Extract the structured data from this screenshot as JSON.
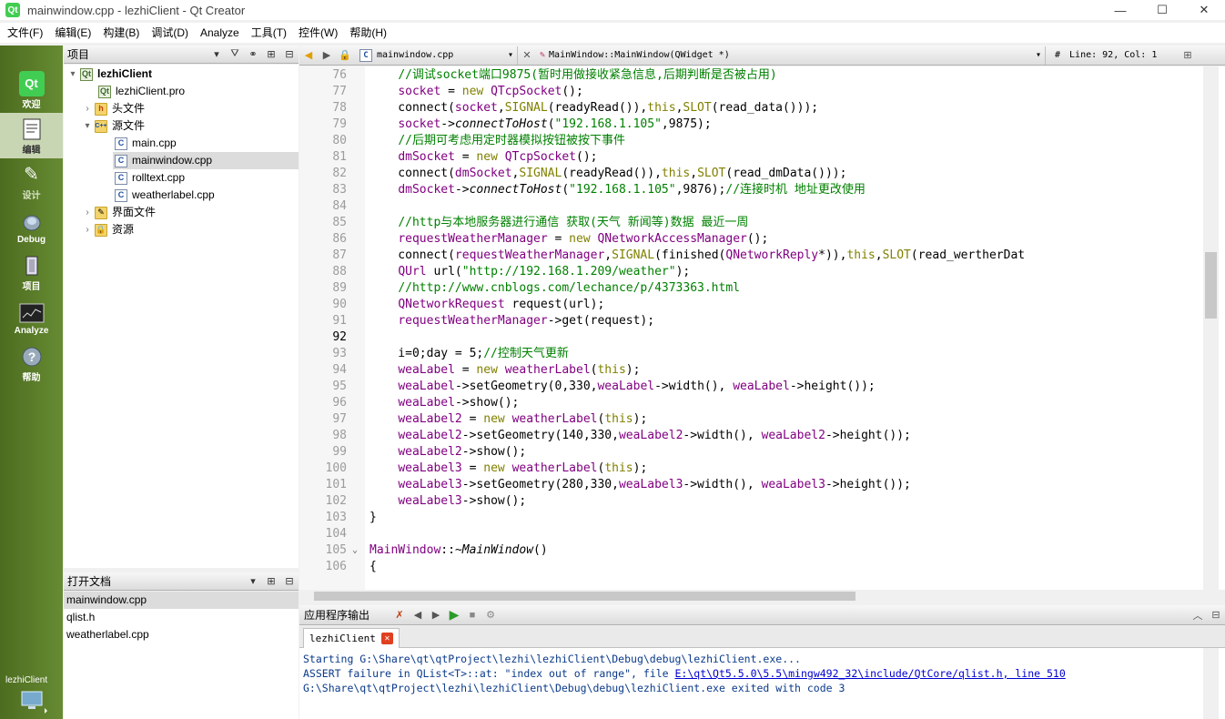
{
  "window": {
    "title": "mainwindow.cpp - lezhiClient - Qt Creator",
    "min": "—",
    "max": "☐",
    "close": "✕"
  },
  "menu": [
    "文件(F)",
    "编辑(E)",
    "构建(B)",
    "调试(D)",
    "Analyze",
    "工具(T)",
    "控件(W)",
    "帮助(H)"
  ],
  "modes": [
    {
      "label": "欢迎",
      "icon": "qt-logo-icon"
    },
    {
      "label": "编辑",
      "icon": "edit-document-icon"
    },
    {
      "label": "设计",
      "icon": "design-pen-icon"
    },
    {
      "label": "Debug",
      "icon": "debug-bug-icon"
    },
    {
      "label": "项目",
      "icon": "project-wrench-icon"
    },
    {
      "label": "Analyze",
      "icon": "analyze-chart-icon"
    },
    {
      "label": "帮助",
      "icon": "help-icon"
    }
  ],
  "kit": {
    "project": "lezhiClient"
  },
  "projects_panel": {
    "title": "项目"
  },
  "tree": [
    {
      "label": "lezhiClient",
      "type": "project"
    },
    {
      "label": "lezhiClient.pro",
      "type": "pro"
    },
    {
      "label": "头文件",
      "type": "folder-h"
    },
    {
      "label": "源文件",
      "type": "folder-cpp"
    },
    {
      "label": "main.cpp",
      "type": "cpp"
    },
    {
      "label": "mainwindow.cpp",
      "type": "cpp"
    },
    {
      "label": "rolltext.cpp",
      "type": "cpp"
    },
    {
      "label": "weatherlabel.cpp",
      "type": "cpp"
    },
    {
      "label": "界面文件",
      "type": "folder-ui"
    },
    {
      "label": "资源",
      "type": "folder-res"
    }
  ],
  "open_docs": {
    "title": "打开文档",
    "items": [
      "mainwindow.cpp",
      "qlist.h",
      "weatherlabel.cpp"
    ]
  },
  "editor_toolbar": {
    "file": "mainwindow.cpp",
    "symbol": "MainWindow::MainWindow(QWidget *)",
    "hash": "#",
    "position": "Line: 92, Col: 1"
  },
  "code": [
    {
      "n": "76",
      "t": "    //调试socket端口9875(暂时用做接收紧急信息,后期判断是否被占用)"
    },
    {
      "n": "77",
      "t": "    socket = new QTcpSocket();"
    },
    {
      "n": "78",
      "t": "    connect(socket,SIGNAL(readyRead()),this,SLOT(read_data()));"
    },
    {
      "n": "79",
      "t": "    socket->connectToHost(\"192.168.1.105\",9875);"
    },
    {
      "n": "80",
      "t": "    //后期可考虑用定时器模拟按钮被按下事件"
    },
    {
      "n": "81",
      "t": "    dmSocket = new QTcpSocket();"
    },
    {
      "n": "82",
      "t": "    connect(dmSocket,SIGNAL(readyRead()),this,SLOT(read_dmData()));"
    },
    {
      "n": "83",
      "t": "    dmSocket->connectToHost(\"192.168.1.105\",9876);//连接时机 地址更改使用"
    },
    {
      "n": "84",
      "t": ""
    },
    {
      "n": "85",
      "t": "    //http与本地服务器进行通信 获取(天气 新闻等)数据 最近一周"
    },
    {
      "n": "86",
      "t": "    requestWeatherManager = new QNetworkAccessManager();"
    },
    {
      "n": "87",
      "t": "    connect(requestWeatherManager,SIGNAL(finished(QNetworkReply*)),this,SLOT(read_wertherDat"
    },
    {
      "n": "88",
      "t": "    QUrl url(\"http://192.168.1.209/weather\");"
    },
    {
      "n": "89",
      "t": "    //http://www.cnblogs.com/lechance/p/4373363.html"
    },
    {
      "n": "90",
      "t": "    QNetworkRequest request(url);"
    },
    {
      "n": "91",
      "t": "    requestWeatherManager->get(request);"
    },
    {
      "n": "92",
      "t": ""
    },
    {
      "n": "93",
      "t": "    i=0;day = 5;//控制天气更新"
    },
    {
      "n": "94",
      "t": "    weaLabel = new weatherLabel(this);"
    },
    {
      "n": "95",
      "t": "    weaLabel->setGeometry(0,330,weaLabel->width(), weaLabel->height());"
    },
    {
      "n": "96",
      "t": "    weaLabel->show();"
    },
    {
      "n": "97",
      "t": "    weaLabel2 = new weatherLabel(this);"
    },
    {
      "n": "98",
      "t": "    weaLabel2->setGeometry(140,330,weaLabel2->width(), weaLabel2->height());"
    },
    {
      "n": "99",
      "t": "    weaLabel2->show();"
    },
    {
      "n": "100",
      "t": "    weaLabel3 = new weatherLabel(this);"
    },
    {
      "n": "101",
      "t": "    weaLabel3->setGeometry(280,330,weaLabel3->width(), weaLabel3->height());"
    },
    {
      "n": "102",
      "t": "    weaLabel3->show();"
    },
    {
      "n": "103",
      "t": "}"
    },
    {
      "n": "104",
      "t": ""
    },
    {
      "n": "105",
      "t": "MainWindow::~MainWindow()"
    },
    {
      "n": "106",
      "t": "{"
    }
  ],
  "output": {
    "title": "应用程序输出",
    "tab": "lezhiClient",
    "lines": [
      "Starting G:\\Share\\qt\\qtProject\\lezhi\\lezhiClient\\Debug\\debug\\lezhiClient.exe...",
      "ASSERT failure in QList<T>::at: \"index out of range\", file ",
      "G:\\Share\\qt\\qtProject\\lezhi\\lezhiClient\\Debug\\debug\\lezhiClient.exe exited with code 3"
    ],
    "link": "E:\\qt\\Qt5.5.0\\5.5\\mingw492_32\\include/QtCore/qlist.h, line 510"
  }
}
